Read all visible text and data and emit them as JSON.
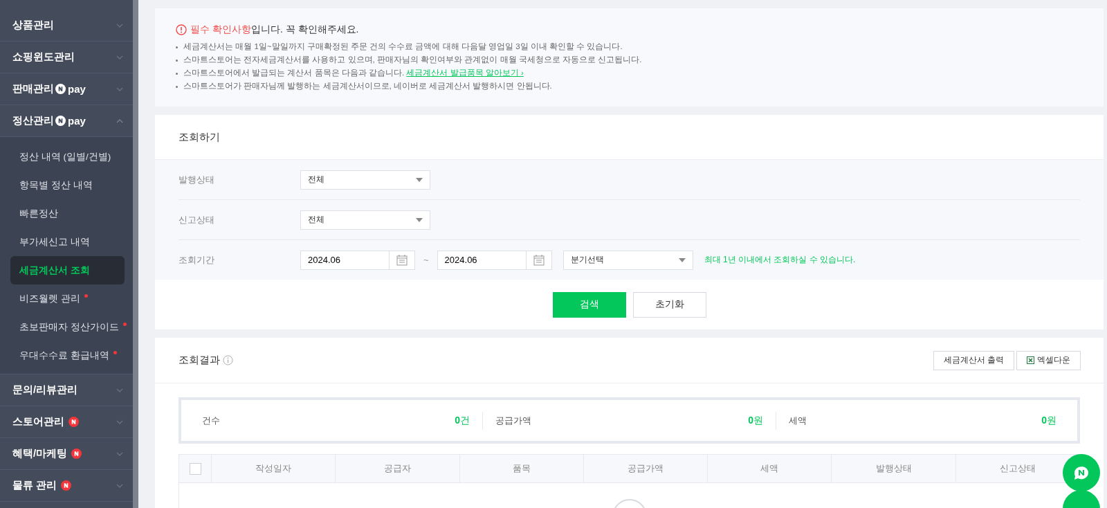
{
  "sidebar": {
    "items": [
      {
        "label": "상품관리",
        "kind": "plain",
        "expanded": false
      },
      {
        "label": "쇼핑윈도관리",
        "kind": "plain",
        "expanded": false
      },
      {
        "label": "판매관리",
        "kind": "npay",
        "badge_text": "pay",
        "expanded": false
      },
      {
        "label": "정산관리",
        "kind": "npay",
        "badge_text": "pay",
        "expanded": true,
        "children": [
          {
            "label": "정산 내역 (일별/건별)",
            "selected": false,
            "dot": false
          },
          {
            "label": "항목별 정산 내역",
            "selected": false,
            "dot": false
          },
          {
            "label": "빠른정산",
            "selected": false,
            "dot": false
          },
          {
            "label": "부가세신고 내역",
            "selected": false,
            "dot": false
          },
          {
            "label": "세금계산서 조회",
            "selected": true,
            "dot": false
          },
          {
            "label": "비즈월렛 관리",
            "selected": false,
            "dot": true
          },
          {
            "label": "초보판매자 정산가이드",
            "selected": false,
            "dot": true
          },
          {
            "label": "우대수수료 환급내역",
            "selected": false,
            "dot": true
          }
        ]
      },
      {
        "label": "문의/리뷰관리",
        "kind": "plain",
        "expanded": false
      },
      {
        "label": "스토어관리",
        "kind": "new",
        "expanded": false
      },
      {
        "label": "혜택/마케팅",
        "kind": "new",
        "expanded": false
      },
      {
        "label": "물류 관리",
        "kind": "new",
        "expanded": false
      }
    ]
  },
  "notice": {
    "title": [
      {
        "text": "필수 확인사항",
        "emphasis": true
      },
      {
        "text": "입니다.  꼭 확인해주세요.",
        "emphasis": false
      }
    ],
    "bullets": [
      {
        "text": "세금계산서는 매월 1일~말일까지 구매확정된 주문 건의 수수료 금액에 대해 다음달 영업일 3일 이내 확인할 수 있습니다."
      },
      {
        "text": "스마트스토어는 전자세금계산서를 사용하고 있으며, 판매자님의 확인여부와 관계없이 매월 국세청으로 자동으로 신고됩니다."
      },
      {
        "text": "스마트스토어에서 발급되는 계산서 품목은 다음과 같습니다.",
        "link": "세금계산서 발급품목 알아보기 ›"
      },
      {
        "text": "스마트스토어가 판매자님께 발행하는 세금계산서이므로, 네이버로 세금계산서 발행하시면 안됩니다."
      }
    ]
  },
  "search": {
    "title": "조회하기",
    "rows": [
      {
        "label": "발행상태",
        "kind": "select",
        "value": "전체"
      },
      {
        "label": "신고상태",
        "kind": "select",
        "value": "전체"
      },
      {
        "label": "조회기간",
        "kind": "period",
        "from": "2024.06",
        "separator": "~",
        "to": "2024.06",
        "quarter": "분기선택",
        "hint": "최대 1년 이내에서 조회하실 수 있습니다."
      }
    ],
    "buttons": [
      {
        "label": "검색",
        "primary": true
      },
      {
        "label": "초기화",
        "primary": false
      }
    ]
  },
  "results": {
    "title": "조회결과",
    "actions": [
      {
        "label": "세금계산서 출력",
        "icon": false
      },
      {
        "label": "엑셀다운",
        "icon": true
      }
    ],
    "summary": [
      {
        "label": "건수",
        "value": "**0**건"
      },
      {
        "label": "공급가액",
        "value": "**0**원"
      },
      {
        "label": "세액",
        "value": "**0**원"
      }
    ],
    "table": {
      "select_all": {
        "checked": false
      },
      "columns": [
        "작성일자",
        "공급자",
        "품목",
        "공급가액",
        "세액",
        "발행상태",
        "신고상태"
      ]
    }
  }
}
